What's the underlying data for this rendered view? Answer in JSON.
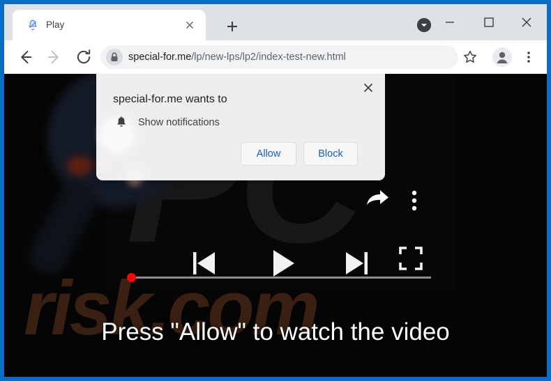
{
  "browser": {
    "tab": {
      "title": "Play",
      "favicon_icon": "bell-slash-icon",
      "close_icon": "close-icon"
    },
    "new_tab_icon": "plus-icon",
    "window_controls": {
      "download_badge_icon": "chevron-down-circle-icon",
      "minimize_icon": "minimize-icon",
      "maximize_icon": "maximize-icon",
      "close_icon": "close-icon"
    },
    "toolbar": {
      "back_icon": "arrow-left-icon",
      "forward_icon": "arrow-right-icon",
      "reload_icon": "reload-icon",
      "lock_icon": "lock-icon",
      "url_host": "special-for.me",
      "url_path": "/lp/new-lps/lp2/index-test-new.html",
      "bookmark_icon": "star-icon",
      "profile_icon": "avatar-icon",
      "menu_icon": "three-dots-vertical-icon"
    }
  },
  "permission_dialog": {
    "title": "special-for.me wants to",
    "option_icon": "bell-icon",
    "option_label": "Show notifications",
    "allow_label": "Allow",
    "block_label": "Block",
    "close_icon": "close-icon",
    "accent_color": "#1a5fb4"
  },
  "page": {
    "watermark_top": "PC",
    "watermark_bottom": "risk.com",
    "cta_text": "Press \"Allow\" to watch the video",
    "player": {
      "share_icon": "share-arrow-icon",
      "menu_icon": "three-dots-vertical-icon",
      "previous_icon": "skip-previous-icon",
      "play_icon": "play-icon",
      "next_icon": "skip-next-icon",
      "fullscreen_icon": "fullscreen-icon",
      "progress_percent": 0,
      "progress_knob_color": "#f00b0b",
      "progress_track_color": "#8d8d8d"
    }
  },
  "colors": {
    "frame_blue": "#0b6cc4",
    "tabstrip": "#dee1e6",
    "omnibox": "#f1f3f4",
    "page_background": "#050505"
  }
}
